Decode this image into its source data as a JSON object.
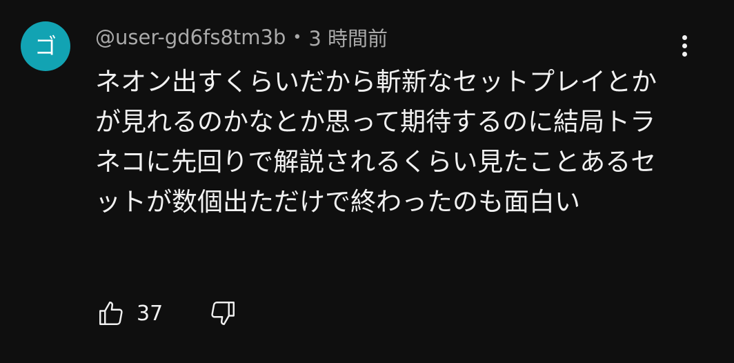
{
  "comment": {
    "avatar_letter": "ゴ",
    "avatar_color": "#12a3b3",
    "username": "@user-gd6fs8tm3b",
    "separator": "•",
    "timestamp": "3 時間前",
    "text": "ネオン出すくらいだから斬新なセットプレイとかが見れるのかなとか思って期待するのに結局トラネコに先回りで解説されるくらい見たことあるセットが数個出ただけで終わったのも面白い",
    "like_count": "37",
    "icons": {
      "like": "thumbs-up-icon",
      "dislike": "thumbs-down-icon",
      "menu": "more-vert-icon"
    }
  }
}
